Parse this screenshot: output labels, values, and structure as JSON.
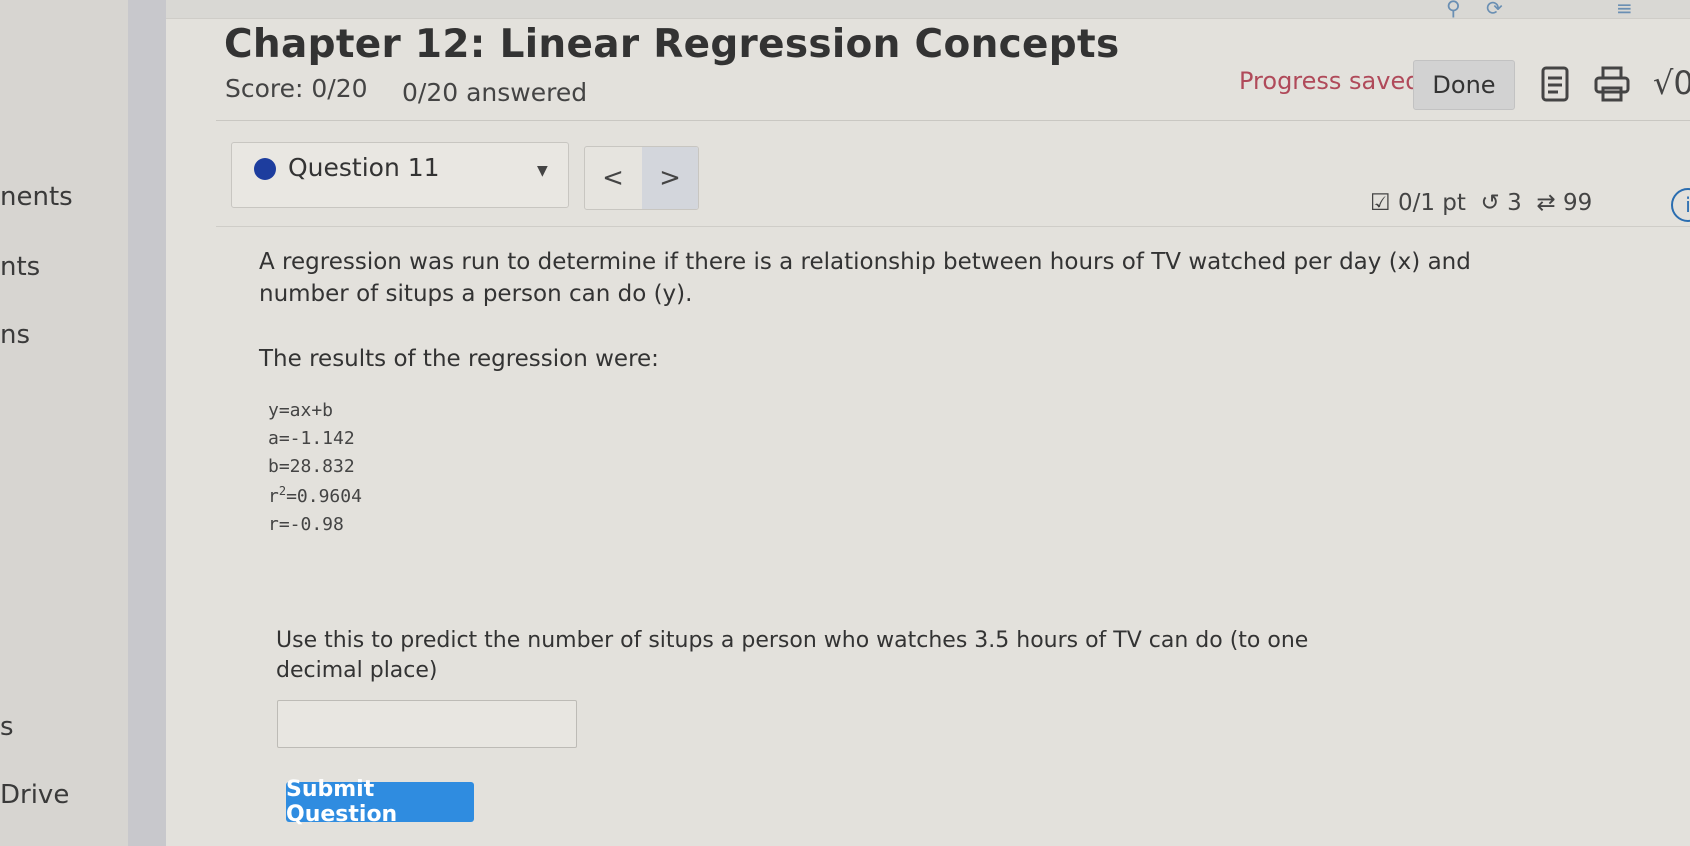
{
  "sidebar": {
    "items": [
      {
        "label": "nents"
      },
      {
        "label": "nts"
      },
      {
        "label": "ns"
      },
      {
        "label": "s"
      },
      {
        "label": "Drive"
      }
    ]
  },
  "header": {
    "title": "Chapter 12: Linear Regression Concepts",
    "score": "Score: 0/20",
    "answered": "0/20 answered",
    "progress_status": "Progress saved",
    "done_label": "Done"
  },
  "question_nav": {
    "label": "Question 11",
    "prev_glyph": "<",
    "next_glyph": ">"
  },
  "question_meta": {
    "points": "0/1 pt",
    "attempts": "3",
    "retries": "99"
  },
  "question": {
    "prompt": "A regression was run to determine if there is a relationship between hours of TV watched per day (x) and number of situps a person can do (y).",
    "results_intro": "The results of the regression were:",
    "equation": "y=ax+b",
    "a": "a=-1.142",
    "b": "b=28.832",
    "r2_prefix": "r",
    "r2_sup": "2",
    "r2_value": "=0.9604",
    "r": "r=-0.98",
    "predict_prompt": "Use this to predict the number of situps a person who watches 3.5 hours of TV can do (to one decimal place)",
    "answer_value": "",
    "submit_label": "Submit Question"
  },
  "icons": {
    "calculator": "calculator-icon",
    "print": "print-icon",
    "math": "sqrt-icon",
    "notes": "notes-icon"
  },
  "colors": {
    "accent": "#2f8ce0",
    "progress_saved": "#b04a5a",
    "question_dot": "#1d3d9e"
  }
}
